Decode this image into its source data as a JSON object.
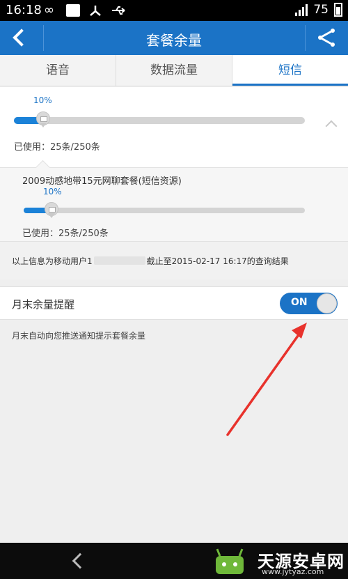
{
  "status_bar": {
    "time": "16:18",
    "battery": "75",
    "icons": [
      "infinity-icon",
      "chat-icon",
      "network-icon",
      "usb-icon",
      "signal-icon",
      "battery-icon"
    ]
  },
  "header": {
    "title": "套餐余量",
    "back_icon": "back-icon",
    "share_icon": "share-icon"
  },
  "tabs": [
    {
      "label": "语音",
      "active": false
    },
    {
      "label": "数据流量",
      "active": false
    },
    {
      "label": "短信",
      "active": true
    }
  ],
  "summary": {
    "percent_label": "10%",
    "percent_value": 0.1,
    "used_text": "已使用：25条/250条"
  },
  "package": {
    "name": "2009动感地带15元网聊套餐(短信资源)",
    "percent_label": "10%",
    "percent_value": 0.1,
    "used_text": "已使用：25条/250条"
  },
  "query_info": {
    "prefix": "以上信息为移动用户1",
    "suffix": "截止至2015-02-17 16:17的查询结果"
  },
  "reminder": {
    "label": "月末余量提醒",
    "toggle_state": "ON",
    "description": "月末自动向您推送通知提示套餐余量"
  },
  "watermark": {
    "text": "天源安卓网",
    "url": "www.jytyaz.com"
  },
  "colors": {
    "accent": "#1b73c6",
    "arrow": "#e8322c"
  }
}
